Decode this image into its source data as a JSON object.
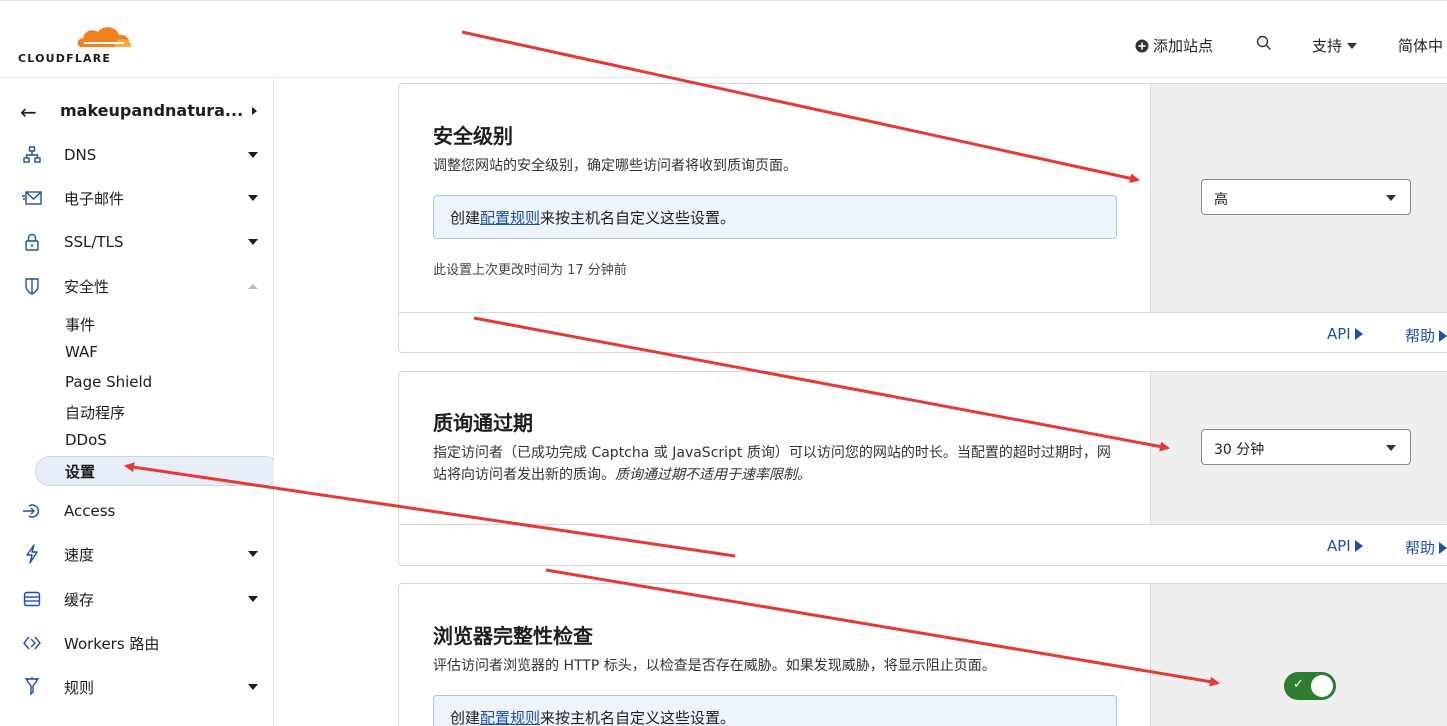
{
  "brand": {
    "wordmark": "CLOUDFLARE",
    "accent": "#f38020"
  },
  "topnav": {
    "add_site": "添加站点",
    "support": "支持",
    "language": "简体中"
  },
  "sidebar": {
    "zone_name": "makeupandnatura...",
    "items": [
      {
        "label": "DNS",
        "icon": "dns-icon"
      },
      {
        "label": "电子邮件",
        "icon": "email-icon"
      },
      {
        "label": "SSL/TLS",
        "icon": "lock-icon"
      },
      {
        "label": "安全性",
        "icon": "shield-icon"
      },
      {
        "label": "Access",
        "icon": "access-icon"
      },
      {
        "label": "速度",
        "icon": "lightning-icon"
      },
      {
        "label": "缓存",
        "icon": "cache-icon"
      },
      {
        "label": "Workers 路由",
        "icon": "workers-icon"
      },
      {
        "label": "规则",
        "icon": "rules-icon"
      }
    ],
    "security_sub": [
      "事件",
      "WAF",
      "Page Shield",
      "自动程序",
      "DDoS",
      "设置"
    ]
  },
  "cards": {
    "security_level": {
      "title": "安全级别",
      "description": "调整您网站的安全级别，确定哪些访问者将收到质询页面。",
      "info_prefix": "创建",
      "info_link": "配置规则",
      "info_suffix": "来按主机名自定义这些设置。",
      "meta": "此设置上次更改时间为 17 分钟前",
      "select_value": "高",
      "api": "API",
      "help": "帮助"
    },
    "challenge_passage": {
      "title": "质询通过期",
      "description": "指定访问者（已成功完成 Captcha 或 JavaScript 质询）可以访问您的网站的时长。当配置的超时过期时，网站将向访问者发出新的质询。",
      "description_em": "质询通过期不适用于速率限制。",
      "select_value": "30 分钟",
      "api": "API",
      "help": "帮助"
    },
    "browser_integrity": {
      "title": "浏览器完整性检查",
      "description": "评估访问者浏览器的 HTTP 标头，以检查是否存在威胁。如果发现威胁，将显示阻止页面。",
      "info_prefix": "创建",
      "info_link": "配置规则",
      "info_suffix": "来按主机名自定义这些设置。",
      "toggle_on": true
    }
  },
  "colors": {
    "link": "#1e4fa8",
    "toggle_on": "#2e7d32",
    "annotation_arrow": "#e53935"
  }
}
